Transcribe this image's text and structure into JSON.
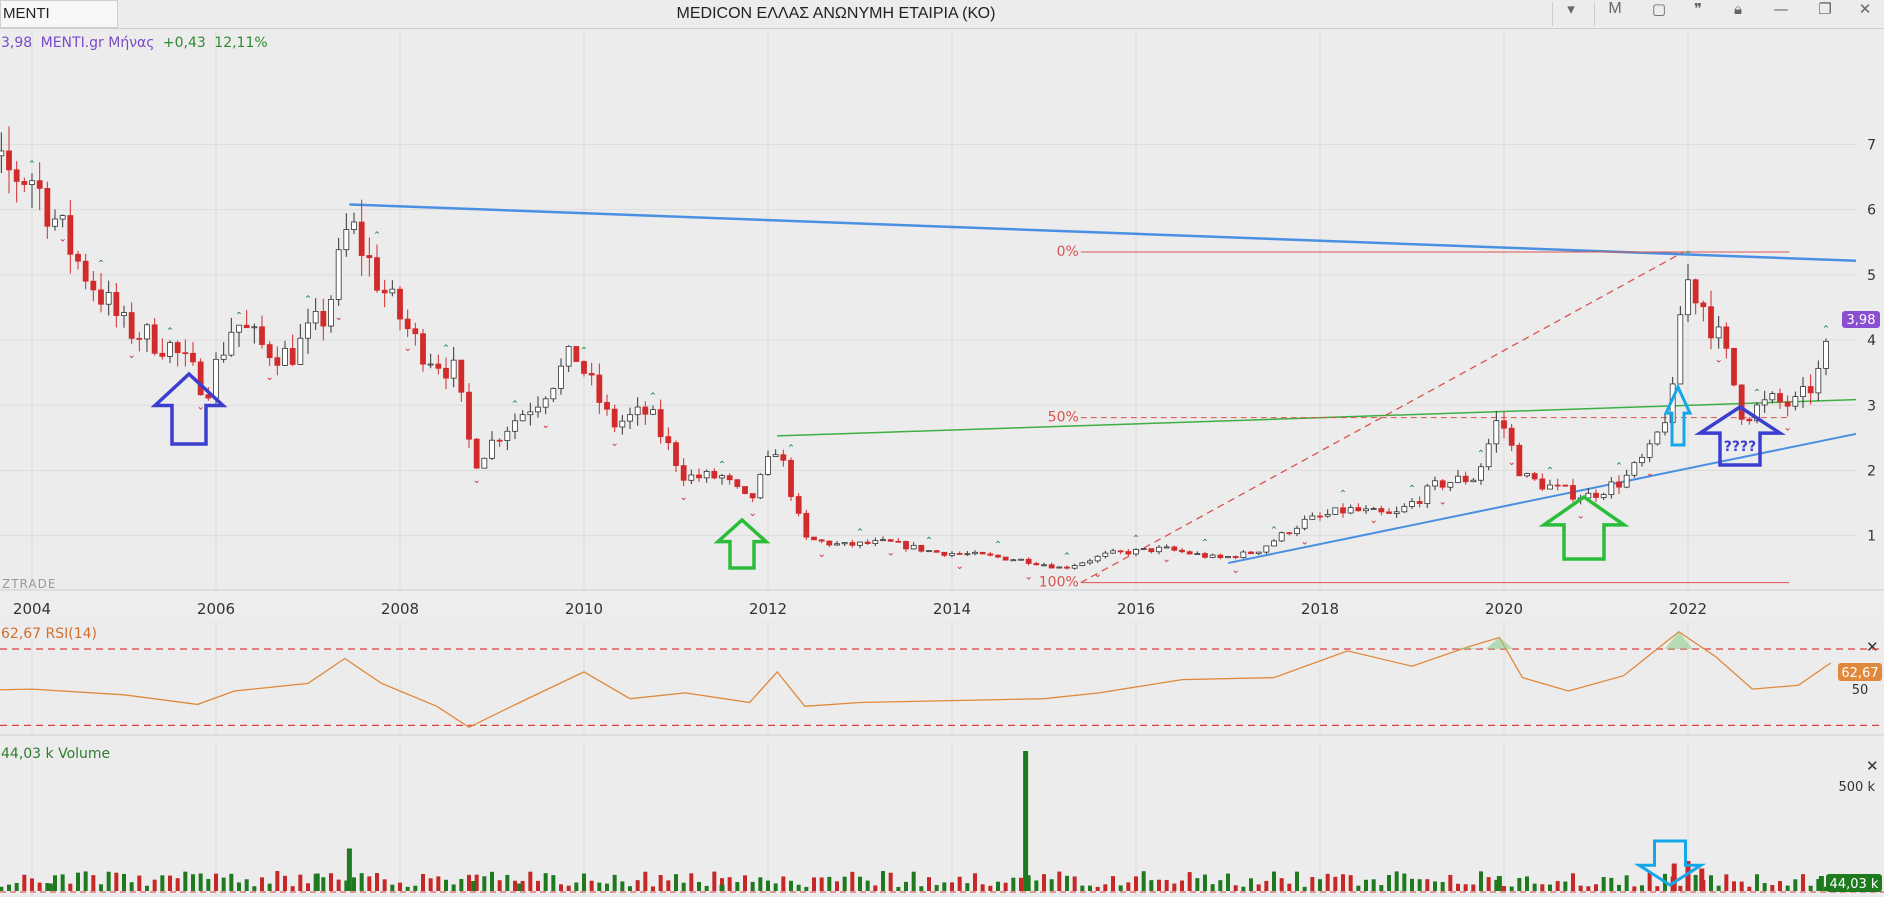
{
  "window": {
    "symbol": "MENTI",
    "title": "MEDICON ΕΛΛΑΣ ΑΝΩΝΥΜΗ ΕΤΑΙΡΙΑ (ΚΟ)",
    "period_button": "M"
  },
  "info": {
    "price": "3,98",
    "label": "MENTI.gr Μήνας",
    "change": "+0,43",
    "change_pct": "12,11%"
  },
  "watermark": "ZTRADE",
  "colors": {
    "up": "#ffffff",
    "down": "#d22b2b",
    "resistance": "#4a90e2",
    "support_green": "#3cb043",
    "fib": "#d9534f",
    "rsi": "#e0883b",
    "volume_up": "#1f7a1f",
    "volume_down": "#c62828",
    "arrow_blue": "#3a3fd0",
    "arrow_green": "#2bbd3a",
    "arrow_cyan": "#14a8e8"
  },
  "chart_data": {
    "type": "candlestick",
    "x_axis_years": [
      "2004",
      "2006",
      "2008",
      "2010",
      "2012",
      "2014",
      "2016",
      "2018",
      "2020",
      "2022"
    ],
    "y_ticks": [
      "1",
      "2",
      "3",
      "4",
      "5",
      "6",
      "7"
    ],
    "ylim": [
      0.55,
      7.6
    ],
    "last_price": "3,98",
    "fib_labels": [
      "0%",
      "50%",
      "100%"
    ],
    "fib_levels": [
      5.35,
      2.81,
      0.28
    ],
    "arrow_label": "????",
    "close_series": [
      {
        "t": 2003.0,
        "v": 5.9
      },
      {
        "t": 2003.5,
        "v": 6.6
      },
      {
        "t": 2004.0,
        "v": 6.5
      },
      {
        "t": 2004.5,
        "v": 5.2
      },
      {
        "t": 2005.0,
        "v": 4.2
      },
      {
        "t": 2005.5,
        "v": 3.9
      },
      {
        "t": 2005.9,
        "v": 3.25
      },
      {
        "t": 2006.2,
        "v": 4.3
      },
      {
        "t": 2006.5,
        "v": 3.9
      },
      {
        "t": 2006.8,
        "v": 3.75
      },
      {
        "t": 2007.2,
        "v": 4.4
      },
      {
        "t": 2007.45,
        "v": 5.8
      },
      {
        "t": 2007.8,
        "v": 4.8
      },
      {
        "t": 2008.2,
        "v": 3.9
      },
      {
        "t": 2008.6,
        "v": 3.5
      },
      {
        "t": 2008.8,
        "v": 2.1
      },
      {
        "t": 2009.1,
        "v": 2.6
      },
      {
        "t": 2009.5,
        "v": 3.1
      },
      {
        "t": 2009.9,
        "v": 3.8
      },
      {
        "t": 2010.3,
        "v": 2.7
      },
      {
        "t": 2010.7,
        "v": 2.9
      },
      {
        "t": 2011.1,
        "v": 1.9
      },
      {
        "t": 2011.5,
        "v": 1.9
      },
      {
        "t": 2011.8,
        "v": 1.5
      },
      {
        "t": 2012.1,
        "v": 2.4
      },
      {
        "t": 2012.4,
        "v": 0.95
      },
      {
        "t": 2012.8,
        "v": 0.85
      },
      {
        "t": 2013.3,
        "v": 0.9
      },
      {
        "t": 2013.8,
        "v": 0.75
      },
      {
        "t": 2014.3,
        "v": 0.7
      },
      {
        "t": 2014.8,
        "v": 0.62
      },
      {
        "t": 2015.2,
        "v": 0.5
      },
      {
        "t": 2015.7,
        "v": 0.72
      },
      {
        "t": 2016.3,
        "v": 0.8
      },
      {
        "t": 2016.9,
        "v": 0.65
      },
      {
        "t": 2017.3,
        "v": 0.75
      },
      {
        "t": 2017.8,
        "v": 1.2
      },
      {
        "t": 2018.3,
        "v": 1.4
      },
      {
        "t": 2018.8,
        "v": 1.3
      },
      {
        "t": 2019.3,
        "v": 1.8
      },
      {
        "t": 2019.7,
        "v": 1.9
      },
      {
        "t": 2019.95,
        "v": 2.85
      },
      {
        "t": 2020.2,
        "v": 1.9
      },
      {
        "t": 2020.6,
        "v": 1.7
      },
      {
        "t": 2020.9,
        "v": 1.6
      },
      {
        "t": 2021.3,
        "v": 1.85
      },
      {
        "t": 2021.6,
        "v": 2.3
      },
      {
        "t": 2021.85,
        "v": 3.2
      },
      {
        "t": 2021.95,
        "v": 5.0
      },
      {
        "t": 2022.15,
        "v": 4.6
      },
      {
        "t": 2022.4,
        "v": 3.8
      },
      {
        "t": 2022.6,
        "v": 2.85
      },
      {
        "t": 2022.9,
        "v": 3.05
      },
      {
        "t": 2023.2,
        "v": 3.0
      },
      {
        "t": 2023.45,
        "v": 3.55
      },
      {
        "t": 2023.55,
        "v": 3.98
      }
    ],
    "rsi": {
      "label": "62,67 RSI(14)",
      "value": "62,67",
      "ticks": [
        "50"
      ],
      "levels": [
        70,
        30
      ],
      "series": [
        {
          "t": 2003.0,
          "v": 48
        },
        {
          "t": 2004.0,
          "v": 49
        },
        {
          "t": 2005.0,
          "v": 46
        },
        {
          "t": 2005.8,
          "v": 41
        },
        {
          "t": 2006.2,
          "v": 48
        },
        {
          "t": 2007.0,
          "v": 52
        },
        {
          "t": 2007.4,
          "v": 65
        },
        {
          "t": 2007.8,
          "v": 52
        },
        {
          "t": 2008.4,
          "v": 40
        },
        {
          "t": 2008.75,
          "v": 29
        },
        {
          "t": 2009.3,
          "v": 42
        },
        {
          "t": 2010.0,
          "v": 58
        },
        {
          "t": 2010.5,
          "v": 44
        },
        {
          "t": 2011.1,
          "v": 47
        },
        {
          "t": 2011.8,
          "v": 42
        },
        {
          "t": 2012.1,
          "v": 58
        },
        {
          "t": 2012.4,
          "v": 40
        },
        {
          "t": 2013.0,
          "v": 42
        },
        {
          "t": 2014.0,
          "v": 43
        },
        {
          "t": 2015.0,
          "v": 44
        },
        {
          "t": 2015.6,
          "v": 47
        },
        {
          "t": 2016.5,
          "v": 54
        },
        {
          "t": 2017.5,
          "v": 55
        },
        {
          "t": 2018.3,
          "v": 69
        },
        {
          "t": 2019.0,
          "v": 61
        },
        {
          "t": 2019.6,
          "v": 71
        },
        {
          "t": 2019.95,
          "v": 76
        },
        {
          "t": 2020.2,
          "v": 55
        },
        {
          "t": 2020.7,
          "v": 48
        },
        {
          "t": 2021.3,
          "v": 56
        },
        {
          "t": 2021.9,
          "v": 79
        },
        {
          "t": 2022.3,
          "v": 66
        },
        {
          "t": 2022.7,
          "v": 49
        },
        {
          "t": 2023.2,
          "v": 51
        },
        {
          "t": 2023.55,
          "v": 62.67
        }
      ]
    },
    "volume": {
      "label": "44,03 k Volume",
      "value": "44,03 k",
      "ticks": [
        "500 k"
      ],
      "spikes": [
        {
          "t": 2003.1,
          "v": 40
        },
        {
          "t": 2003.5,
          "v": 55
        },
        {
          "t": 2004.2,
          "v": 30
        },
        {
          "t": 2007.1,
          "v": 70
        },
        {
          "t": 2007.45,
          "v": 170
        },
        {
          "t": 2008.8,
          "v": 40
        },
        {
          "t": 2009.3,
          "v": 30
        },
        {
          "t": 2011.5,
          "v": 25
        },
        {
          "t": 2014.8,
          "v": 560
        },
        {
          "t": 2019.95,
          "v": 60
        },
        {
          "t": 2021.85,
          "v": 110
        },
        {
          "t": 2022.0,
          "v": 120
        },
        {
          "t": 2022.15,
          "v": 90
        },
        {
          "t": 2023.45,
          "v": 60
        }
      ]
    }
  }
}
